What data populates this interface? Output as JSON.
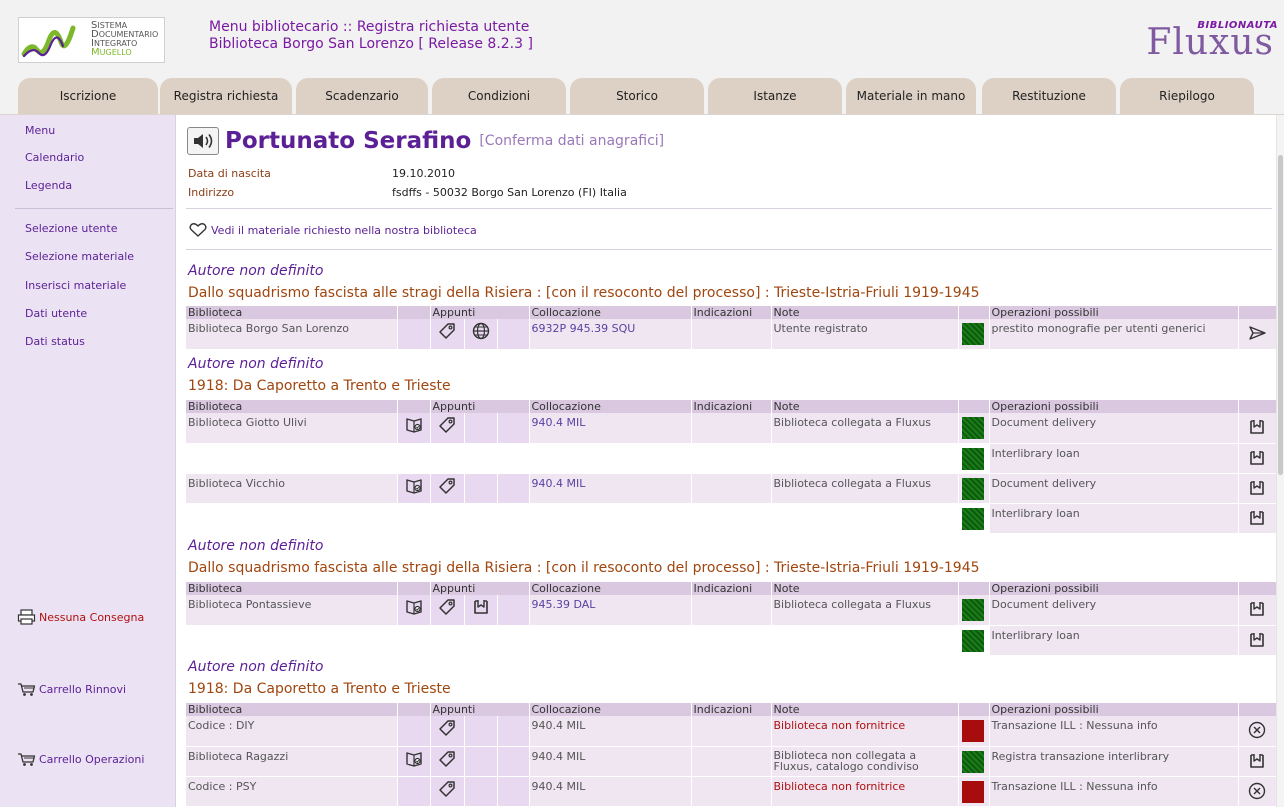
{
  "header": {
    "logo_lines": [
      "Sistema",
      "Documentario",
      "Integrato",
      "Mugello"
    ],
    "title_line1": "Menu bibliotecario :: Registra richiesta utente",
    "title_line2": "Biblioteca Borgo San Lorenzo [ Release 8.2.3 ]",
    "brand_small": "BIBLIONAUTA",
    "brand_big": "Fluxus"
  },
  "tabs": [
    "Iscrizione",
    "Registra richiesta",
    "Scadenzario",
    "Condizioni",
    "Storico",
    "Istanze",
    "Materiale in mano",
    "Restituzione",
    "Riepilogo"
  ],
  "sidebar": {
    "top": [
      "Menu",
      "Calendario",
      "Legenda"
    ],
    "mid": [
      "Selezione utente",
      "Selezione materiale",
      "Inserisci materiale",
      "Dati utente",
      "Dati status"
    ],
    "actions": [
      "Nessuna Consegna",
      "Carrello Rinnovi",
      "Carrello Operazioni"
    ]
  },
  "patron": {
    "name": "Portunato Serafino",
    "confirm": "[Conferma dati anagrafici]",
    "birth_label": "Data di nascita",
    "birth_value": "19.10.2010",
    "address_label": "Indirizzo",
    "address_value": "fsdffs - 50032 Borgo San Lorenzo (FI) Italia",
    "vedi": "Vedi il materiale richiesto nella nostra biblioteca"
  },
  "columns": {
    "biblioteca": "Biblioteca",
    "appunti": "Appunti",
    "collocazione": "Collocazione",
    "indicazioni": "Indicazioni",
    "note": "Note",
    "operazioni": "Operazioni possibili"
  },
  "records": [
    {
      "author": "Autore non definito",
      "title": "Dallo squadrismo fascista alle stragi della Risiera : [con il resoconto del processo] : Trieste-Istria-Friuli 1919-1945",
      "rows": [
        {
          "lib": "Biblioteca Borgo San Lorenzo",
          "coll": "6932P 945.39 SQU",
          "note": "Utente registrato",
          "op": "prestito monografie per utenti generici"
        }
      ]
    },
    {
      "author": "Autore non definito",
      "title": "1918: Da Caporetto a Trento e Trieste",
      "rows": [
        {
          "lib": "Biblioteca Giotto Ulivi",
          "coll": "940.4 MIL",
          "note": "Biblioteca collegata a Fluxus",
          "op": "Document delivery",
          "op2": "Interlibrary loan"
        },
        {
          "lib": "Biblioteca Vicchio",
          "coll": "940.4 MIL",
          "note": "Biblioteca collegata a Fluxus",
          "op": "Document delivery",
          "op2": "Interlibrary loan"
        }
      ]
    },
    {
      "author": "Autore non definito",
      "title": "Dallo squadrismo fascista alle stragi della Risiera : [con il resoconto del processo] : Trieste-Istria-Friuli 1919-1945",
      "rows": [
        {
          "lib": "Biblioteca Pontassieve",
          "coll": "945.39 DAL",
          "note": "Biblioteca collegata a Fluxus",
          "op": "Document delivery",
          "op2": "Interlibrary loan"
        }
      ]
    },
    {
      "author": "Autore non definito",
      "title": "1918: Da Caporetto a Trento e Trieste",
      "rows": [
        {
          "lib": "Codice : DIY",
          "coll": "940.4 MIL",
          "note": "Biblioteca non fornitrice",
          "op": "Transazione ILL : Nessuna info"
        },
        {
          "lib": "Biblioteca Ragazzi",
          "coll": "940.4 MIL",
          "note": "Biblioteca non collegata a Fluxus, catalogo condiviso",
          "op": "Registra transazione interlibrary"
        },
        {
          "lib": "Codice : PSY",
          "coll": "940.4 MIL",
          "note": "Biblioteca non fornitrice",
          "op": "Transazione ILL : Nessuna info"
        }
      ]
    }
  ]
}
